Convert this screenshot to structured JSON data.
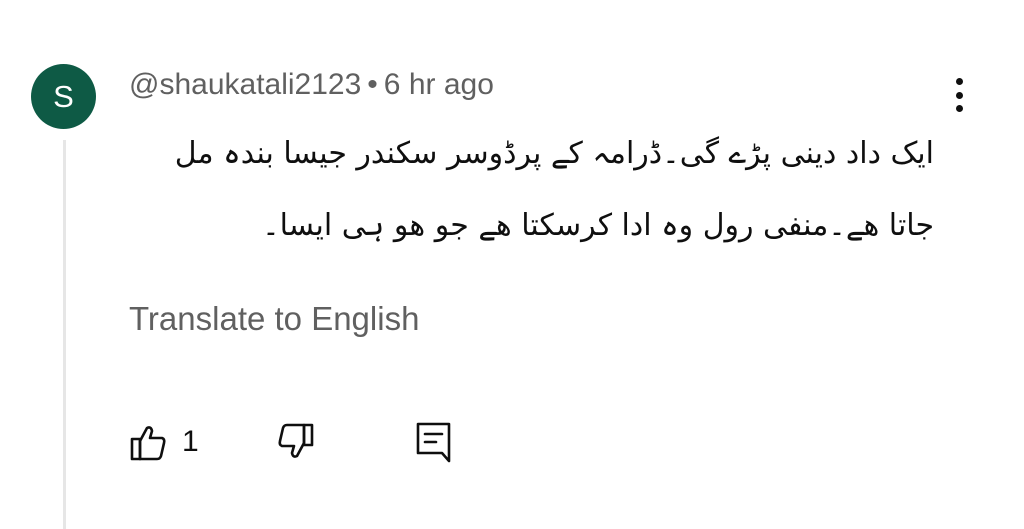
{
  "comment": {
    "avatar_letter": "S",
    "avatar_color": "#0e5a45",
    "author": "@shaukatali2123",
    "separator": "•",
    "time_ago": "6 hr ago",
    "text": "ایک داد دینی پڑے گی۔ڈرامہ کے پرڈوسر سکندر جیسا بندہ مل جاتا ھے۔منفی رول وہ ادا کرسکتا ھے جو ھو ہی ایسا۔",
    "translate_label": "Translate to English",
    "like_count": "1"
  },
  "icons": {
    "more": "vertical-ellipsis-icon",
    "like": "thumbs-up-icon",
    "dislike": "thumbs-down-icon",
    "reply": "comment-reply-icon"
  }
}
